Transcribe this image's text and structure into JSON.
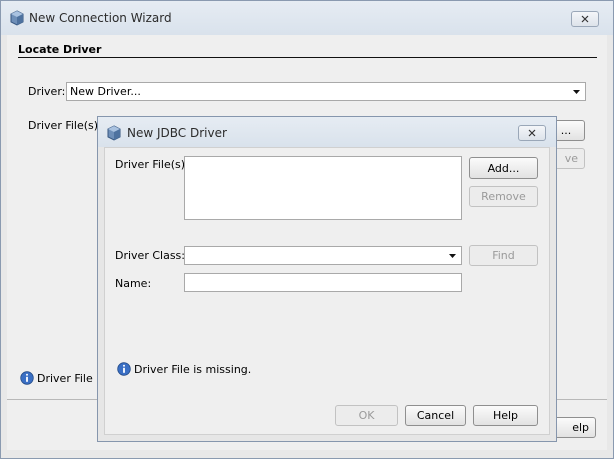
{
  "outer": {
    "title": "New Connection Wizard",
    "section_title": "Locate Driver",
    "driver_label": "Driver:",
    "driver_value": "New Driver...",
    "driver_files_label": "Driver File(s):",
    "add_button_partial": "...",
    "remove_button_partial": "ve",
    "status_text": "Driver File is",
    "help_button_partial": "elp"
  },
  "dialog": {
    "title": "New JDBC Driver",
    "driver_files_label": "Driver File(s):",
    "add_button": "Add...",
    "remove_button": "Remove",
    "driver_class_label": "Driver Class:",
    "driver_class_value": "",
    "find_button": "Find",
    "name_label": "Name:",
    "name_value": "",
    "status_text": "Driver File is missing.",
    "ok_button": "OK",
    "cancel_button": "Cancel",
    "help_button": "Help"
  },
  "icons": {
    "app": "cube-icon",
    "close": "close-icon",
    "dropdown": "chevron-down-icon",
    "info": "info-icon"
  },
  "colors": {
    "info_blue": "#3a6fc4",
    "titlebar": "#dfe6ee"
  }
}
